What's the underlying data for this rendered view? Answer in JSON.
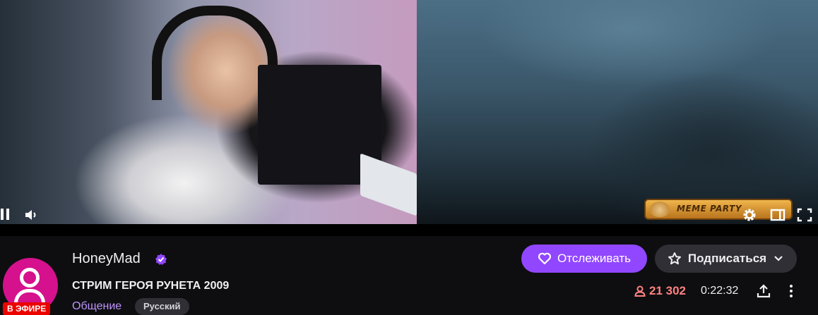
{
  "player": {
    "overlay_badge_text": "MEME PARTY",
    "controls": {
      "pause_icon": "pause-icon",
      "volume_icon": "volume-icon",
      "settings_icon": "gear-icon",
      "theatre_icon": "theatre-mode-icon",
      "fullscreen_icon": "fullscreen-icon"
    }
  },
  "channel": {
    "name": "HoneyMad",
    "verified": true,
    "live_badge": "В ЭФИРЕ",
    "stream_title": "СТРИМ ГЕРОЯ РУНЕТА 2009",
    "category": "Общение",
    "tag": "Русский"
  },
  "actions": {
    "follow_label": "Отслеживать",
    "subscribe_label": "Подписаться"
  },
  "stats": {
    "viewers": "21 302",
    "uptime": "0:22:32"
  },
  "colors": {
    "accent": "#9147ff",
    "live": "#eb0400",
    "viewer": "#ff8280",
    "avatar_bg": "#d5118d",
    "category": "#bf94ff"
  }
}
